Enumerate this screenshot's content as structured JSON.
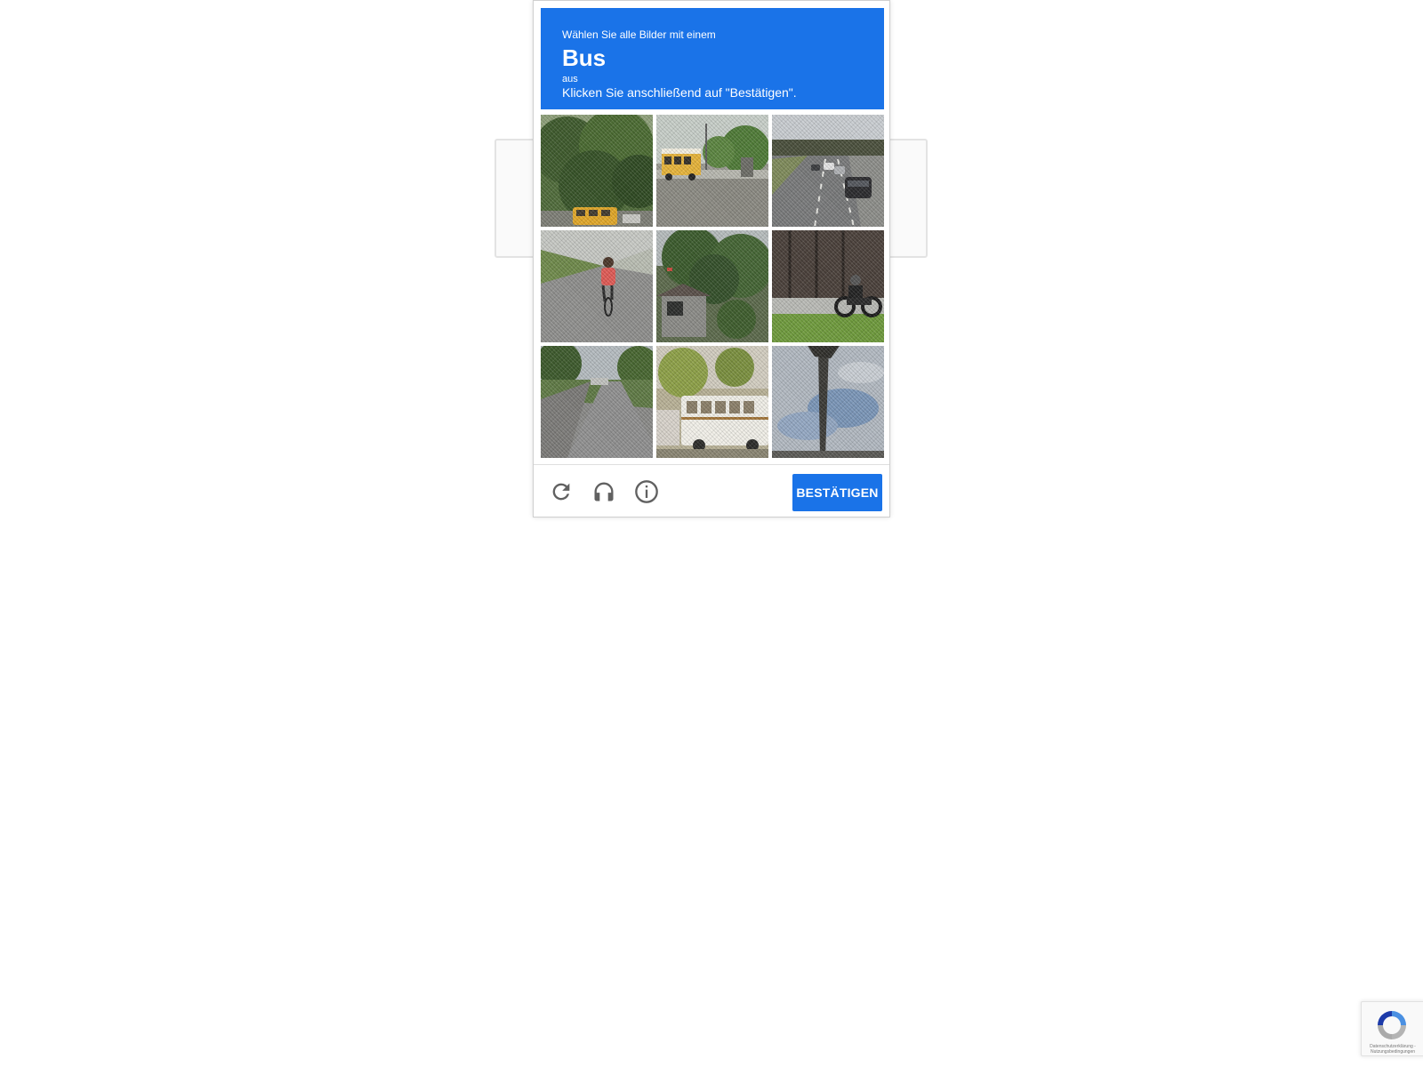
{
  "challenge": {
    "instruction_line1": "Wählen Sie alle Bilder mit einem",
    "keyword": "Bus",
    "instruction_line3": "aus",
    "instruction_line4": "Klicken Sie anschließend auf \"Bestätigen\".",
    "header_color": "#1a73e8",
    "tiles": [
      {
        "index": 1,
        "icon": "trees-with-school-bus-image"
      },
      {
        "index": 2,
        "icon": "school-bus-on-road-image"
      },
      {
        "index": 3,
        "icon": "highway-with-cars-image"
      },
      {
        "index": 4,
        "icon": "cyclist-on-road-image"
      },
      {
        "index": 5,
        "icon": "house-with-bushes-image"
      },
      {
        "index": 6,
        "icon": "motorcycle-rider-image"
      },
      {
        "index": 7,
        "icon": "empty-road-image"
      },
      {
        "index": 8,
        "icon": "white-bus-image"
      },
      {
        "index": 9,
        "icon": "palm-tree-sky-image"
      }
    ]
  },
  "footer": {
    "reload_icon": "reload-icon",
    "audio_icon": "headphones-icon",
    "info_icon": "info-icon",
    "verify_label": "BESTÄTIGEN"
  },
  "badge": {
    "privacy_text": "Datenschutzerklärung - Nutzungsbedingungen"
  }
}
